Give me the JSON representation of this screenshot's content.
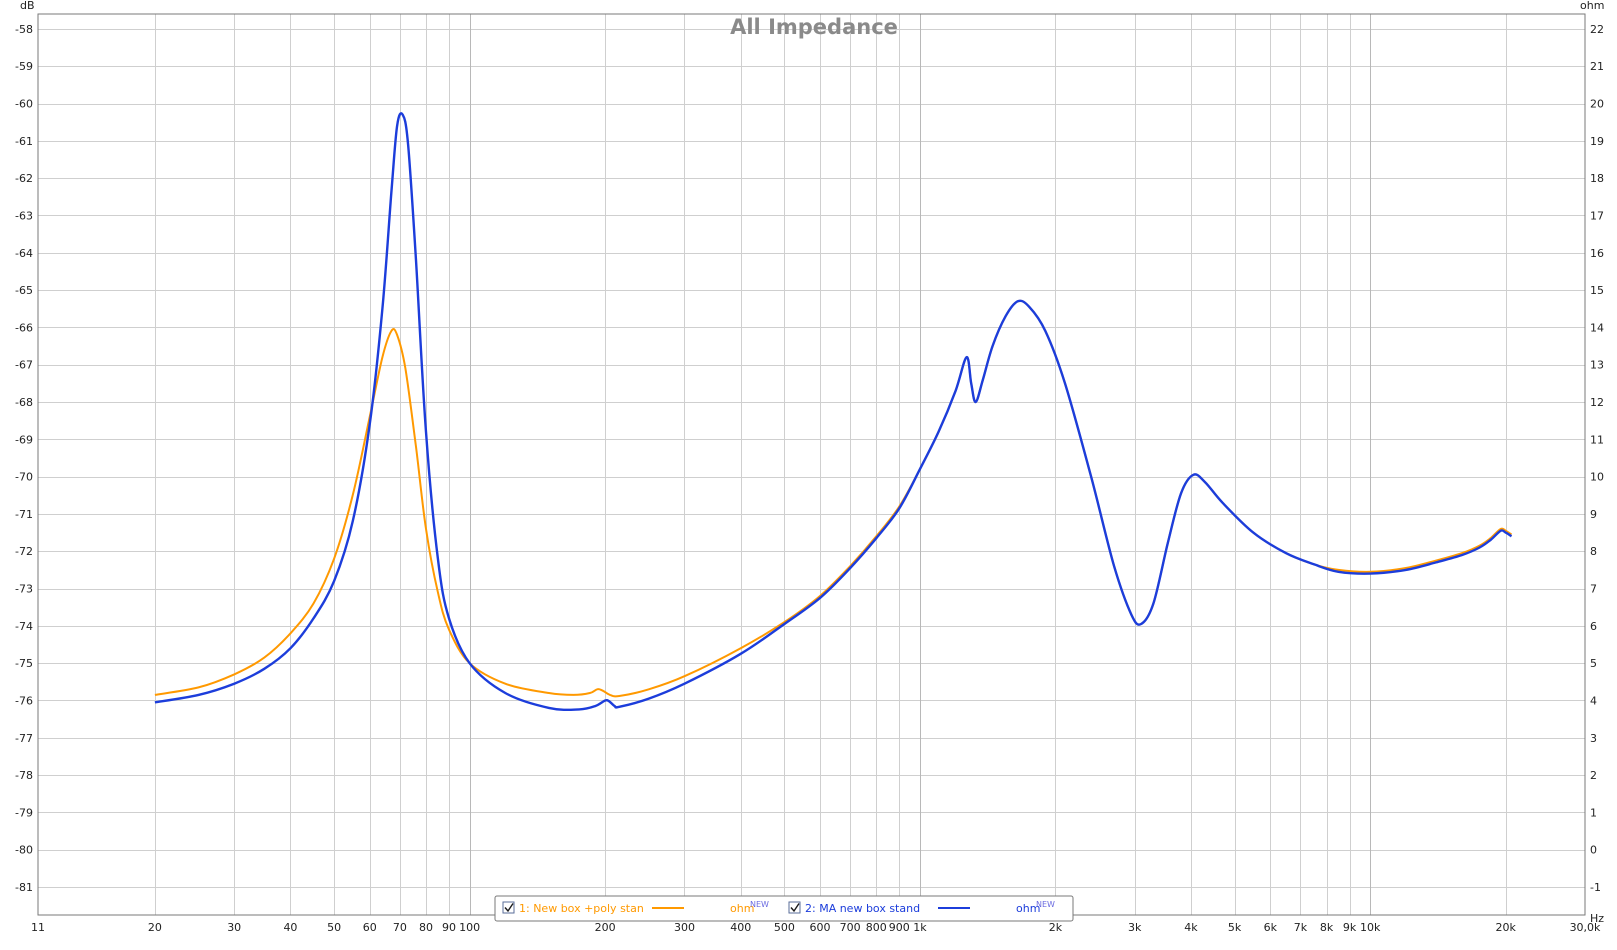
{
  "chart_data": {
    "type": "line",
    "title": "All Impedance",
    "left_axis_unit": "dB",
    "right_axis_unit": "ohm",
    "x_unit": "Hz",
    "x_scale": "log",
    "xlim": [
      11,
      30000
    ],
    "ylim_left": [
      -81.75,
      -57.6
    ],
    "ylim_right": [
      -1.75,
      22.4
    ],
    "grid": true,
    "x_ticks": [
      {
        "v": 11,
        "label": "11"
      },
      {
        "v": 20,
        "label": "20"
      },
      {
        "v": 30,
        "label": "30"
      },
      {
        "v": 40,
        "label": "40"
      },
      {
        "v": 50,
        "label": "50"
      },
      {
        "v": 60,
        "label": "60"
      },
      {
        "v": 70,
        "label": "70"
      },
      {
        "v": 80,
        "label": "80"
      },
      {
        "v": 90,
        "label": "90"
      },
      {
        "v": 100,
        "label": "100"
      },
      {
        "v": 200,
        "label": "200"
      },
      {
        "v": 300,
        "label": "300"
      },
      {
        "v": 400,
        "label": "400"
      },
      {
        "v": 500,
        "label": "500"
      },
      {
        "v": 600,
        "label": "600"
      },
      {
        "v": 700,
        "label": "700"
      },
      {
        "v": 800,
        "label": "800"
      },
      {
        "v": 900,
        "label": "900"
      },
      {
        "v": 1000,
        "label": "1k"
      },
      {
        "v": 2000,
        "label": "2k"
      },
      {
        "v": 3000,
        "label": "3k"
      },
      {
        "v": 4000,
        "label": "4k"
      },
      {
        "v": 5000,
        "label": "5k"
      },
      {
        "v": 6000,
        "label": "6k"
      },
      {
        "v": 7000,
        "label": "7k"
      },
      {
        "v": 8000,
        "label": "8k"
      },
      {
        "v": 9000,
        "label": "9k"
      },
      {
        "v": 10000,
        "label": "10k"
      },
      {
        "v": 20000,
        "label": "20k"
      },
      {
        "v": 30000,
        "label": "30,0k"
      }
    ],
    "y_ticks_left": [
      "-58",
      "-59",
      "-60",
      "-61",
      "-62",
      "-63",
      "-64",
      "-65",
      "-66",
      "-67",
      "-68",
      "-69",
      "-70",
      "-71",
      "-72",
      "-73",
      "-74",
      "-75",
      "-76",
      "-77",
      "-78",
      "-79",
      "-80",
      "-81"
    ],
    "y_ticks_right": [
      "22",
      "21",
      "20",
      "19",
      "18",
      "17",
      "16",
      "15",
      "14",
      "13",
      "12",
      "11",
      "10",
      "9",
      "8",
      "7",
      "6",
      "5",
      "4",
      "3",
      "2",
      "1",
      "0",
      "-1"
    ],
    "series": [
      {
        "name": "1: New box +poly stan",
        "unit": "ohm",
        "unit_badge": "NEW",
        "color": "#ff9900",
        "checked": true,
        "points": [
          [
            20,
            4.15
          ],
          [
            25,
            4.35
          ],
          [
            30,
            4.7
          ],
          [
            35,
            5.15
          ],
          [
            40,
            5.8
          ],
          [
            45,
            6.6
          ],
          [
            50,
            7.8
          ],
          [
            55,
            9.5
          ],
          [
            60,
            11.6
          ],
          [
            64,
            13.2
          ],
          [
            67,
            13.9
          ],
          [
            69,
            13.8
          ],
          [
            72,
            12.9
          ],
          [
            76,
            10.8
          ],
          [
            80,
            8.6
          ],
          [
            85,
            6.9
          ],
          [
            90,
            5.9
          ],
          [
            100,
            5.0
          ],
          [
            120,
            4.45
          ],
          [
            150,
            4.2
          ],
          [
            170,
            4.15
          ],
          [
            185,
            4.2
          ],
          [
            192,
            4.3
          ],
          [
            197,
            4.27
          ],
          [
            205,
            4.15
          ],
          [
            215,
            4.12
          ],
          [
            250,
            4.3
          ],
          [
            300,
            4.65
          ],
          [
            400,
            5.4
          ],
          [
            500,
            6.1
          ],
          [
            600,
            6.8
          ],
          [
            700,
            7.6
          ],
          [
            800,
            8.4
          ],
          [
            900,
            9.2
          ],
          [
            1000,
            10.2
          ],
          [
            1100,
            11.2
          ],
          [
            1200,
            12.3
          ],
          [
            1270,
            13.2
          ],
          [
            1300,
            12.5
          ],
          [
            1330,
            12.0
          ],
          [
            1380,
            12.6
          ],
          [
            1450,
            13.5
          ],
          [
            1550,
            14.3
          ],
          [
            1650,
            14.7
          ],
          [
            1750,
            14.55
          ],
          [
            1900,
            13.9
          ],
          [
            2100,
            12.5
          ],
          [
            2400,
            10.0
          ],
          [
            2700,
            7.6
          ],
          [
            2950,
            6.3
          ],
          [
            3100,
            6.05
          ],
          [
            3300,
            6.6
          ],
          [
            3550,
            8.2
          ],
          [
            3800,
            9.55
          ],
          [
            4050,
            10.05
          ],
          [
            4300,
            9.85
          ],
          [
            4700,
            9.3
          ],
          [
            5500,
            8.5
          ],
          [
            6500,
            7.95
          ],
          [
            7500,
            7.65
          ],
          [
            8500,
            7.5
          ],
          [
            10000,
            7.45
          ],
          [
            12000,
            7.55
          ],
          [
            14000,
            7.75
          ],
          [
            16000,
            7.95
          ],
          [
            17500,
            8.15
          ],
          [
            18500,
            8.35
          ],
          [
            19500,
            8.6
          ],
          [
            20000,
            8.55
          ],
          [
            20600,
            8.45
          ]
        ]
      },
      {
        "name": "2: MA new box stand",
        "unit": "ohm",
        "unit_badge": "NEW",
        "color": "#1c3ddb",
        "checked": true,
        "points": [
          [
            20,
            3.95
          ],
          [
            25,
            4.15
          ],
          [
            30,
            4.45
          ],
          [
            35,
            4.85
          ],
          [
            40,
            5.4
          ],
          [
            45,
            6.2
          ],
          [
            50,
            7.2
          ],
          [
            55,
            8.8
          ],
          [
            60,
            11.4
          ],
          [
            64,
            14.5
          ],
          [
            67,
            17.6
          ],
          [
            69,
            19.4
          ],
          [
            71,
            19.7
          ],
          [
            73,
            18.9
          ],
          [
            76,
            15.8
          ],
          [
            80,
            11.2
          ],
          [
            85,
            7.8
          ],
          [
            90,
            6.2
          ],
          [
            100,
            5.0
          ],
          [
            120,
            4.2
          ],
          [
            150,
            3.8
          ],
          [
            175,
            3.76
          ],
          [
            190,
            3.85
          ],
          [
            200,
            4.0
          ],
          [
            204,
            3.98
          ],
          [
            210,
            3.85
          ],
          [
            215,
            3.83
          ],
          [
            250,
            4.05
          ],
          [
            300,
            4.45
          ],
          [
            400,
            5.25
          ],
          [
            500,
            6.05
          ],
          [
            600,
            6.75
          ],
          [
            700,
            7.55
          ],
          [
            800,
            8.35
          ],
          [
            900,
            9.15
          ],
          [
            1000,
            10.2
          ],
          [
            1100,
            11.2
          ],
          [
            1200,
            12.3
          ],
          [
            1270,
            13.2
          ],
          [
            1300,
            12.5
          ],
          [
            1330,
            12.0
          ],
          [
            1380,
            12.6
          ],
          [
            1450,
            13.5
          ],
          [
            1550,
            14.3
          ],
          [
            1650,
            14.7
          ],
          [
            1750,
            14.55
          ],
          [
            1900,
            13.9
          ],
          [
            2100,
            12.5
          ],
          [
            2400,
            10.0
          ],
          [
            2700,
            7.6
          ],
          [
            2950,
            6.3
          ],
          [
            3100,
            6.05
          ],
          [
            3300,
            6.6
          ],
          [
            3550,
            8.2
          ],
          [
            3800,
            9.55
          ],
          [
            4050,
            10.05
          ],
          [
            4300,
            9.85
          ],
          [
            4700,
            9.3
          ],
          [
            5500,
            8.5
          ],
          [
            6500,
            7.95
          ],
          [
            7500,
            7.65
          ],
          [
            8500,
            7.45
          ],
          [
            10000,
            7.4
          ],
          [
            12000,
            7.5
          ],
          [
            14000,
            7.7
          ],
          [
            16000,
            7.9
          ],
          [
            17500,
            8.1
          ],
          [
            18500,
            8.3
          ],
          [
            19500,
            8.55
          ],
          [
            20000,
            8.5
          ],
          [
            20600,
            8.4
          ]
        ]
      }
    ],
    "legend_position": "bottom-center"
  }
}
